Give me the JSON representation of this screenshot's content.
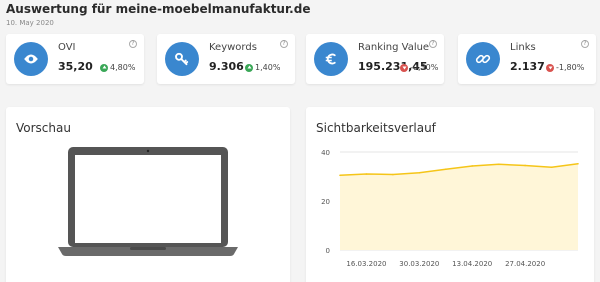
{
  "header": {
    "title": "Auswertung für meine-moebelmanufaktur.de",
    "date": "10. May 2020"
  },
  "kpis": [
    {
      "label": "OVI",
      "value": "35,20",
      "change": "4,80%",
      "direction": "up",
      "icon": "eye-icon"
    },
    {
      "label": "Keywords",
      "value": "9.306",
      "change": "1,40%",
      "direction": "up",
      "icon": "key-icon"
    },
    {
      "label": "Ranking Value",
      "value": "195.231,45",
      "change": "-0,30%",
      "direction": "down",
      "icon": "euro-icon"
    },
    {
      "label": "Links",
      "value": "2.137",
      "change": "-1,80%",
      "direction": "down",
      "icon": "link-icon"
    }
  ],
  "help_symbol": "?",
  "panels": {
    "preview_title": "Vorschau",
    "visibility_title": "Sichtbarkeitsverlauf"
  },
  "colors": {
    "accent": "#3a87cf",
    "up": "#3aa757",
    "down": "#d9534f",
    "line": "#f5c518",
    "area": "#fff6d8"
  },
  "chart_data": {
    "type": "area",
    "title": "Sichtbarkeitsverlauf",
    "xlabel": "",
    "ylabel": "",
    "ylim": [
      0,
      40
    ],
    "yticks": [
      "0",
      "20",
      "40"
    ],
    "xticks": [
      "16.03.2020",
      "30.03.2020",
      "13.04.2020",
      "27.04.2020"
    ],
    "grid": true,
    "x": [
      "09.03.2020",
      "16.03.2020",
      "23.03.2020",
      "30.03.2020",
      "06.04.2020",
      "13.04.2020",
      "20.04.2020",
      "27.04.2020",
      "04.05.2020",
      "10.05.2020"
    ],
    "series": [
      {
        "values": [
          30.5,
          31.0,
          30.8,
          31.5,
          33.0,
          34.3,
          35.0,
          34.5,
          33.8,
          35.2
        ]
      }
    ]
  }
}
